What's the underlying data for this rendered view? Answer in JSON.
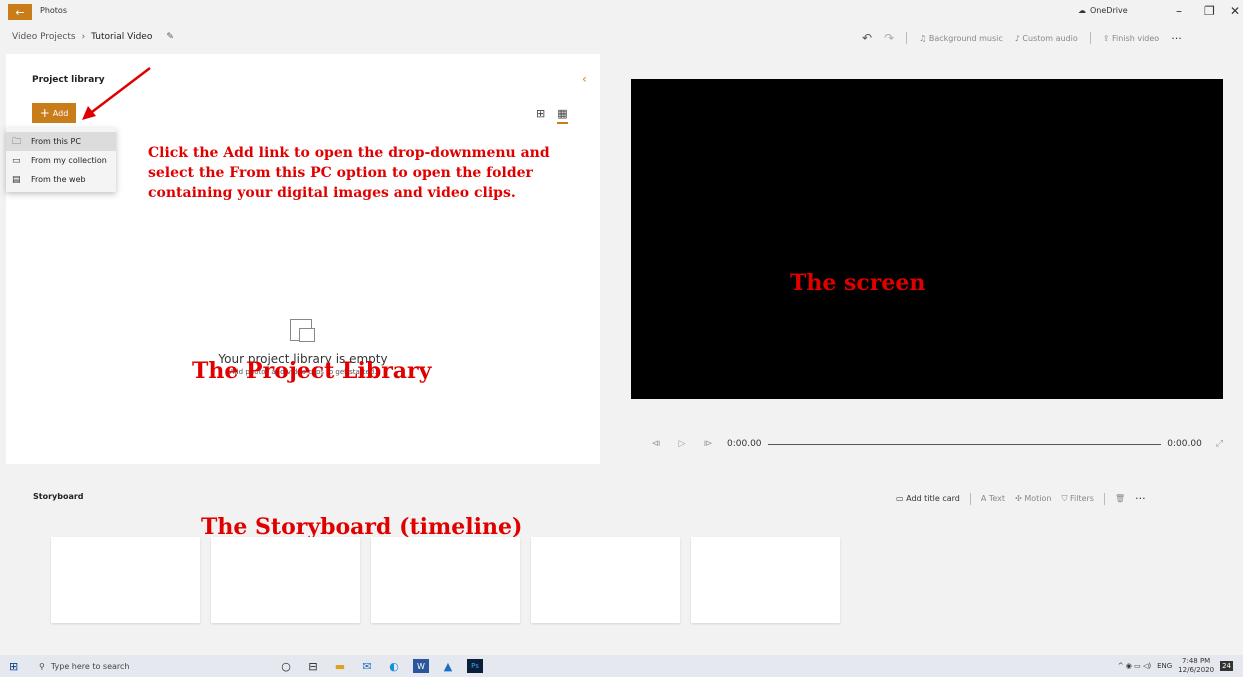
{
  "titlebar": {
    "back_icon": "←",
    "app_title": "Photos",
    "onedrive_label": "OneDrive",
    "minimize": "–",
    "maximize": "❐",
    "close": "✕"
  },
  "breadcrumb": {
    "parent": "Video Projects",
    "separator": "›",
    "current": "Tutorial Video",
    "edit_icon": "✎"
  },
  "top_toolbar": {
    "undo_icon": "↶",
    "redo_icon": "↷",
    "background_music": "Background music",
    "custom_audio": "Custom audio",
    "finish_video": "Finish video",
    "more": "···"
  },
  "library": {
    "title": "Project library",
    "collapse_icon": "‹",
    "add_plus": "+",
    "add_label": "Add",
    "view_grid_icon": "⊞",
    "view_list_icon": "▦",
    "empty_title": "Your project library is empty",
    "empty_subtitle": "Add photos and video clips to get started."
  },
  "add_menu": {
    "items": [
      {
        "label": "From this PC",
        "icon": "pc-folder-icon",
        "glyph": "🗀"
      },
      {
        "label": "From my collection",
        "icon": "collection-icon",
        "glyph": "▭"
      },
      {
        "label": "From the web",
        "icon": "web-icon",
        "glyph": "▤"
      }
    ]
  },
  "annotations": {
    "add_instruction": "Click the Add link to open the drop-downmenu and select the From this PC option to open the folder containing your digital images and video clips.",
    "project_library": "The Project Library",
    "screen": "The screen",
    "storyboard": "The Storyboard (timeline)"
  },
  "player": {
    "prev_icon": "⧏",
    "play_icon": "▷",
    "next_icon": "⧐",
    "current_time": "0:00.00",
    "total_time": "0:00.00",
    "expand_icon": "⤢"
  },
  "storyboard": {
    "title": "Storyboard",
    "add_title_card": "Add title card",
    "text": "Text",
    "motion": "Motion",
    "filters": "Filters",
    "delete_icon": "🗑",
    "more": "···",
    "tile_count_note": ""
  },
  "taskbar": {
    "start_icon": "⊞",
    "search_icon": "⚲",
    "search_placeholder": "Type here to search",
    "apps": [
      "cortana-icon",
      "task-view-icon",
      "file-explorer-icon",
      "mail-icon",
      "edge-icon",
      "word-icon",
      "photos-icon",
      "photoshop-icon"
    ],
    "app_glyphs": [
      "○",
      "⊟",
      "▬",
      "✉",
      "◐",
      "W",
      "▲",
      "Ps"
    ],
    "tray_icons": "^ ◉ ▭ ◁)",
    "lang": "ENG",
    "time": "7:48 PM",
    "date": "12/6/2020",
    "notifications": "24"
  },
  "colors": {
    "accent": "#c97d1a",
    "annotation": "#e00000",
    "screen_bg": "#000000"
  }
}
